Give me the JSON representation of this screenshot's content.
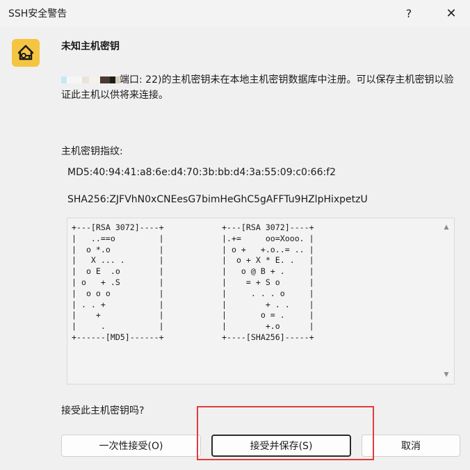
{
  "window": {
    "title": "SSH安全警告",
    "help_glyph": "?",
    "close_glyph": "✕"
  },
  "dialog": {
    "icon": "house-key-icon",
    "heading": "未知主机密钥",
    "message": "端口: 22)的主机密钥未在本地主机密钥数据库中注册。可以保存主机密钥以验证此主机以供将来连接。",
    "fingerprint_label": "主机密钥指纹:",
    "md5": "MD5:40:94:41:a8:6e:d4:70:3b:bb:d4:3a:55:09:c0:66:f2",
    "sha256": "SHA256:ZJFVhN0xCNEesG7bimHeGhC5gAFFTu9HZlpHixpetzU",
    "randomart_md5": "+---[RSA 3072]----+\n|   ..==o         |\n|  o *.o          |\n|   X ... .       |\n|  o E  .o        |\n| o   + .S        |\n|  o o o          |\n| . . +           |\n|    +            |\n|     .           |\n+------[MD5]------+",
    "randomart_sha256": "+---[RSA 3072]----+\n|.+=     oo=Xooo. |\n| o +   +.o..= .. |\n|  o + X * E. .   |\n|   o @ B + .     |\n|    = + S o      |\n|     . . . o     |\n|        + . .    |\n|       o = .     |\n|        +.o      |\n+----[SHA256]-----+",
    "question": "接受此主机密钥吗?"
  },
  "buttons": {
    "accept_once": "一次性接受(O)",
    "accept_save": "接受并保存(S)",
    "cancel": "取消"
  },
  "colors": {
    "icon_bg": "#f5c542",
    "highlight": "#e23b3b"
  }
}
